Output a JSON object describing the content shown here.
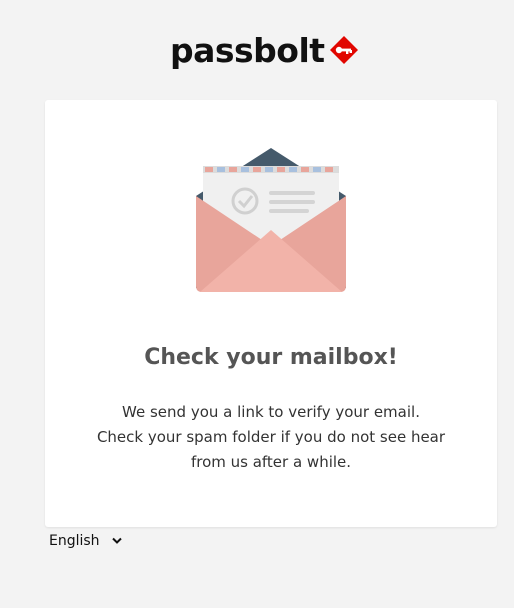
{
  "brand": {
    "name": "passbolt",
    "accent_color": "#e10600"
  },
  "card": {
    "title": "Check your mailbox!",
    "message_lines": [
      "We send you a link to verify your email.",
      "Check your spam folder if you do not see hear",
      "from us after a while."
    ]
  },
  "language_selector": {
    "selected": "English",
    "icon": "chevron-down-icon"
  },
  "colors": {
    "background": "#f3f3f3",
    "card": "#ffffff",
    "title": "#555555",
    "text": "#333333",
    "envelope_back": "#455a6b",
    "envelope_front": "#e8a59b",
    "envelope_flap": "#f2b3a9",
    "letter": "#f0f0f0"
  }
}
